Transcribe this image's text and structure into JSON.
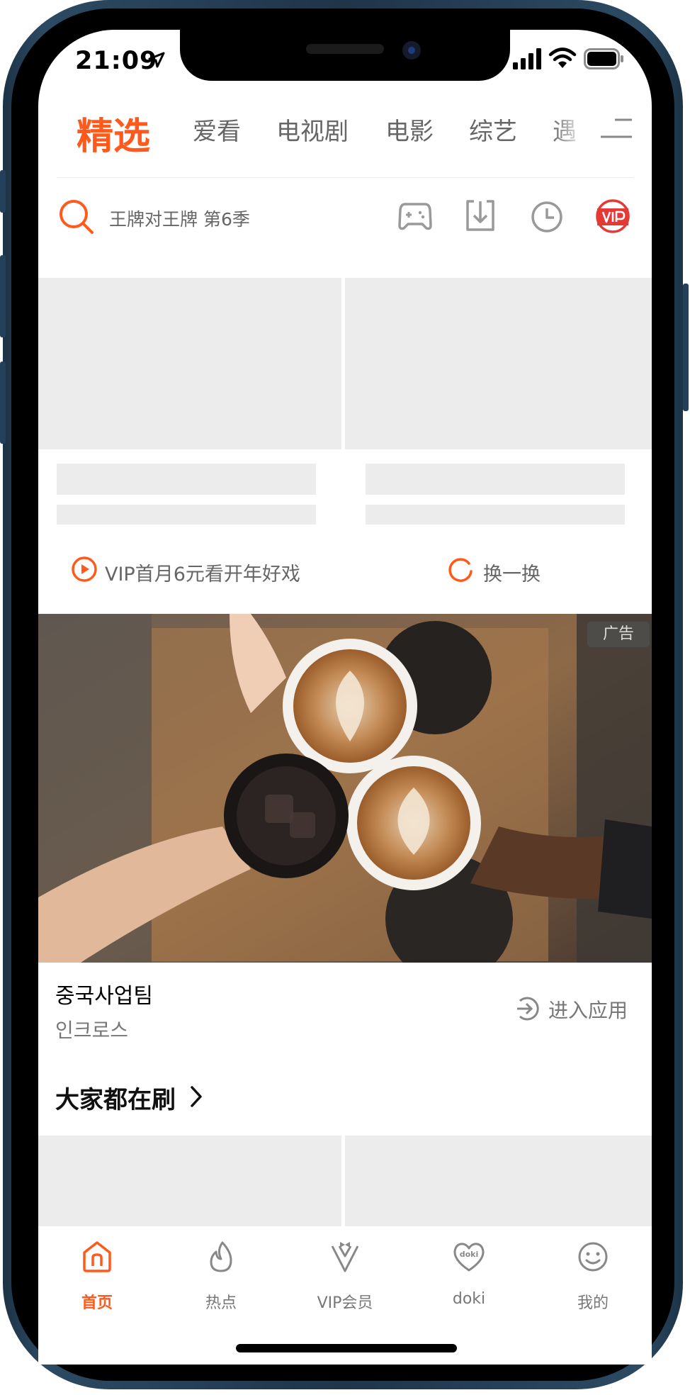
{
  "status_bar": {
    "time": "21:09"
  },
  "tabs": [
    "精选",
    "爱看",
    "电视剧",
    "电影",
    "综艺",
    "遇"
  ],
  "search": {
    "placeholder": "王牌对王牌 第6季"
  },
  "vip_hint": "VIP首月6元看开年好戏",
  "refresh_label": "换一换",
  "ad": {
    "badge": "广告",
    "title": "중국사업팀",
    "subtitle": "인크로스",
    "enter_label": "进入应用"
  },
  "section_title": "大家都在刷",
  "bottom_nav": [
    {
      "label": "首页",
      "icon": "home-icon",
      "active": true
    },
    {
      "label": "热点",
      "icon": "flame-icon"
    },
    {
      "label": "VIP会员",
      "icon": "vip-tuxedo-icon"
    },
    {
      "label": "doki",
      "icon": "doki-heart-icon"
    },
    {
      "label": "我的",
      "icon": "smiley-icon"
    }
  ],
  "colors": {
    "accent": "#ff5a1c",
    "vip_red": "#e53935",
    "text_gray": "#666666",
    "skeleton": "#ececec"
  }
}
